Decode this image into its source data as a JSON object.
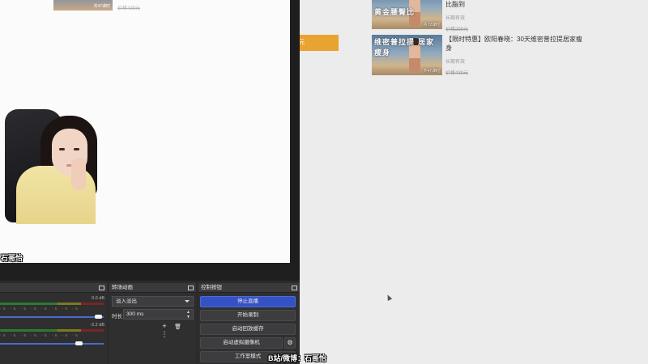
{
  "webpage": {
    "courses": [
      {
        "thumb_title": "黄金腰臀比",
        "thumb_sub": "",
        "lesson_count": "共72课时",
        "title": "比脂到",
        "meta": "长期有效",
        "price": "价格299元"
      },
      {
        "thumb_title": "维密普拉提 居家瘦身",
        "thumb_sub": "",
        "lesson_count": "共47课时",
        "title": "【限时特惠】欧阳春晓：30天维密普拉提居家瘦身",
        "meta": "长期有效",
        "price": "价格439元"
      }
    ],
    "orange_button_label": "元"
  },
  "obs": {
    "preview": {
      "card_lessons": "共47课时",
      "card_price": "价格439元",
      "streamer_name": "石哥怡"
    },
    "audio_mixer": {
      "channels": [
        {
          "db": "0.0 dB",
          "ticks": "-5 -5 -5 -5 -5 -5 -5 -5",
          "level": 0.98
        },
        {
          "db": "-2.2 dB",
          "ticks": "-5 -5 -5 -5 -5 -5 -5 -5",
          "level": 0.78
        }
      ]
    },
    "transitions": {
      "header": "转场动画",
      "selected": "淡入淡出",
      "duration_label": "时长",
      "duration_value": "300 ms",
      "add_label": "+",
      "remove_label": "🗑",
      "more_label": "⋮"
    },
    "controls": {
      "header": "控制按钮",
      "buttons": [
        {
          "label": "停止直播"
        },
        {
          "label": "开始录制"
        },
        {
          "label": "启动回放缓存"
        },
        {
          "label": "启动虚拟摄像机"
        },
        {
          "label": "工作室模式"
        }
      ],
      "gear_label": "⚙"
    }
  },
  "overlay": {
    "bottom_watermark": "B站/微博：石哥怡"
  },
  "colors": {
    "accent_blue": "#3552c5",
    "orange": "#e8a330",
    "panel_bg": "#2f2f30"
  }
}
